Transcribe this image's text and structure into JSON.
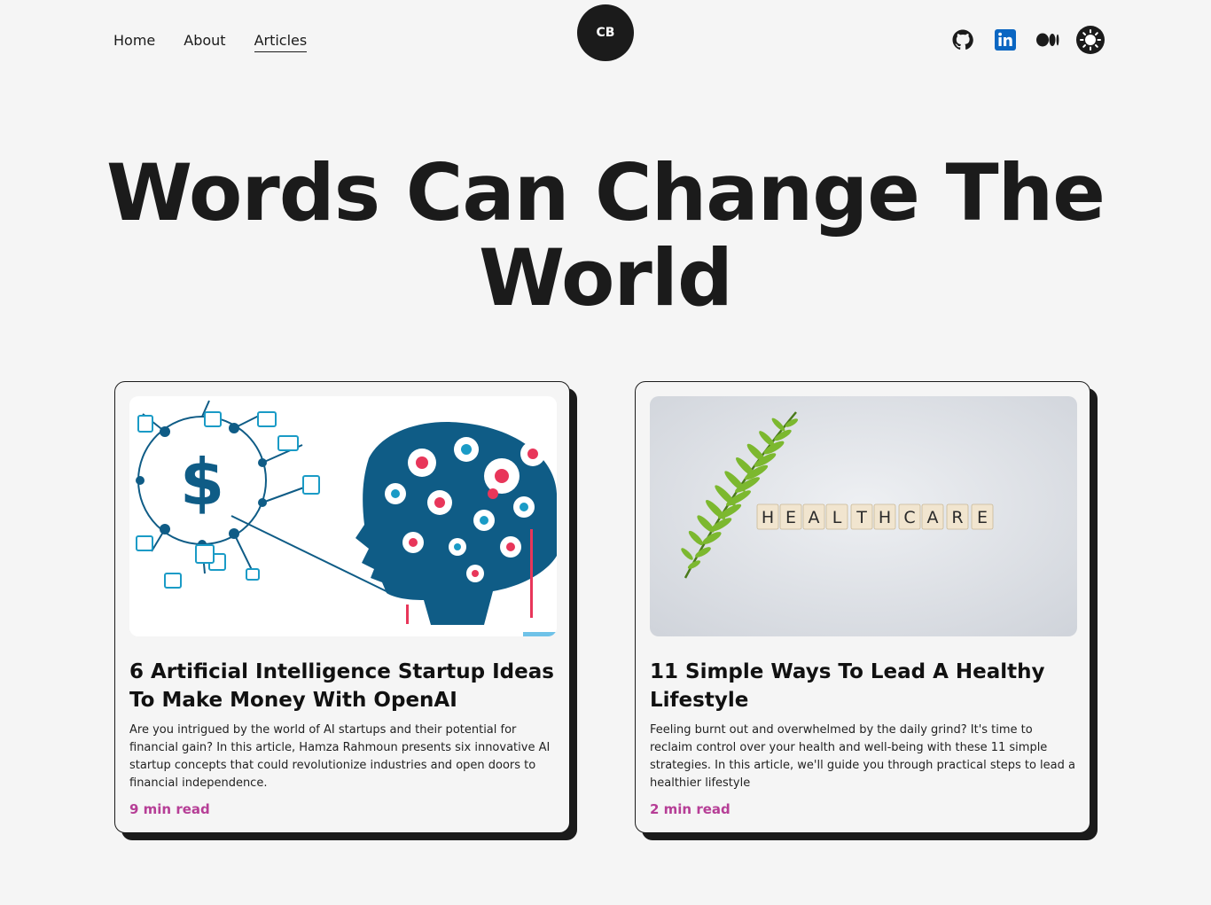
{
  "header": {
    "nav": [
      {
        "label": "Home"
      },
      {
        "label": "About"
      },
      {
        "label": "Articles",
        "active": true
      }
    ],
    "logo_text": "CB",
    "social_icons": [
      "github-icon",
      "linkedin-icon",
      "medium-icon",
      "theme-toggle-sun-icon"
    ]
  },
  "hero": {
    "line1": "Words Can Change The",
    "line2": "World"
  },
  "articles": [
    {
      "title": "6 Artificial Intelligence Startup Ideas To Make Money With OpenAI",
      "summary": "Are you intrigued by the world of AI startups and their potential for financial gain? In this article, Hamza Rahmoun presents six innovative AI startup concepts that could revolutionize industries and open doors to financial independence.",
      "read_time": "9 min read",
      "image": "ai-money-head-illustration"
    },
    {
      "title": "11 Simple Ways To Lead A Healthy Lifestyle",
      "summary": "Feeling burnt out and overwhelmed by the daily grind? It's time to reclaim control over your health and well-being with these 11 simple strategies. In this article, we'll guide you through practical steps to lead a healthier lifestyle",
      "read_time": "2 min read",
      "image": "healthcare-letter-tiles-fern",
      "image_text": "HEALTHCARE"
    }
  ],
  "colors": {
    "background": "#f5f5f5",
    "text": "#1b1b1b",
    "accent": "#b63e96",
    "linkedin": "#0a66c2",
    "illustration_blue": "#0f5c86"
  }
}
